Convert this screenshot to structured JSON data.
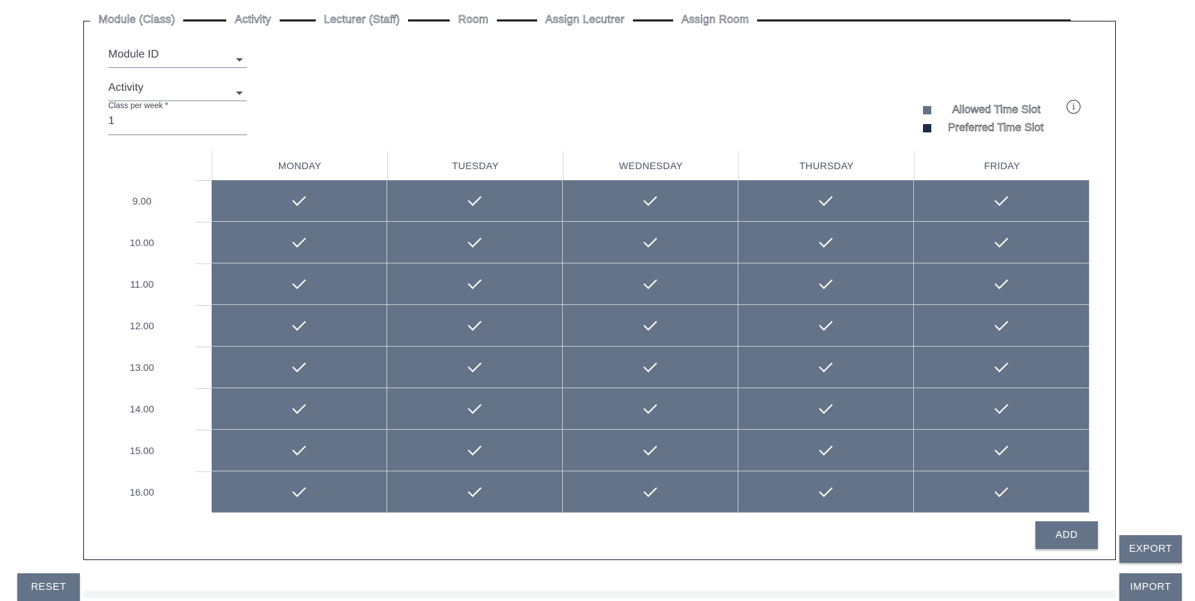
{
  "steps": [
    "Module (Class)",
    "Activity",
    "Lecturer (Staff)",
    "Room",
    "Assign Lecutrer",
    "Assign Room"
  ],
  "form": {
    "module_id_label": "Module ID",
    "activity_label": "Activity",
    "class_per_week_label": "Class per week *",
    "class_per_week_value": "1"
  },
  "legend": {
    "allowed_label": "Allowed Time Slot",
    "preferred_label": "Preferred Time Slot",
    "allowed_color": "#647388",
    "preferred_color": "#1d2b48"
  },
  "timetable": {
    "days": [
      "MONDAY",
      "TUESDAY",
      "WEDNESDAY",
      "THURSDAY",
      "FRIDAY"
    ],
    "times": [
      "9.00",
      "10.00",
      "11.00",
      "12.00",
      "13.00",
      "14.00",
      "15.00",
      "16.00"
    ],
    "cell_status": "allowed",
    "cell_checked": true
  },
  "buttons": {
    "add": "ADD",
    "export": "EXPORT",
    "reset": "RESET",
    "import": "IMPORT"
  }
}
